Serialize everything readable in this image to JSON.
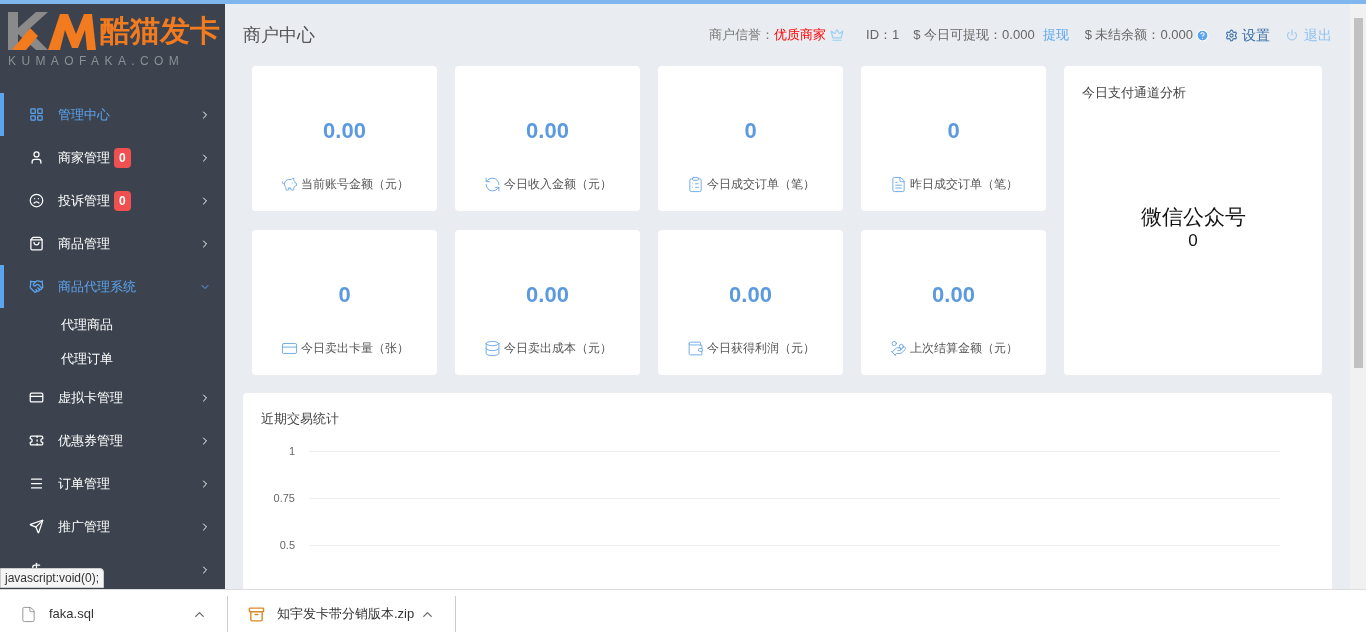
{
  "logo": {
    "brand": "酷猫发卡",
    "domain": "KUMAOFAKA.COM"
  },
  "sidebar": {
    "items": [
      {
        "label": "管理中心",
        "selected": true,
        "expanded": false
      },
      {
        "label": "商家管理",
        "badge": "0",
        "selected": false,
        "expanded": false
      },
      {
        "label": "投诉管理",
        "badge": "0",
        "selected": false,
        "expanded": false
      },
      {
        "label": "商品管理",
        "selected": false,
        "expanded": false
      },
      {
        "label": "商品代理系统",
        "selected": true,
        "expanded": true,
        "children": [
          {
            "label": "代理商品"
          },
          {
            "label": "代理订单"
          }
        ]
      },
      {
        "label": "虚拟卡管理",
        "selected": false,
        "expanded": false
      },
      {
        "label": "优惠券管理",
        "selected": false,
        "expanded": false
      },
      {
        "label": "订单管理",
        "selected": false,
        "expanded": false
      },
      {
        "label": "推广管理",
        "selected": false,
        "expanded": false
      },
      {
        "selected": false,
        "expanded": false
      }
    ]
  },
  "header": {
    "title": "商户中心",
    "reputation_label": "商户信誉：",
    "reputation": "优质商家",
    "id": "ID：1",
    "withdrawable": "$ 今日可提现：0.000",
    "withdraw_link": "提现",
    "unsettled": "$ 未结余额：0.000",
    "settings": "设置",
    "logout": "退出"
  },
  "stats": [
    {
      "value": "0.00",
      "label": "当前账号金额（元）"
    },
    {
      "value": "0.00",
      "label": "今日收入金额（元）"
    },
    {
      "value": "0",
      "label": "今日成交订单（笔）"
    },
    {
      "value": "0",
      "label": "昨日成交订单（笔）"
    },
    {
      "value": "0",
      "label": "今日卖出卡量（张）"
    },
    {
      "value": "0.00",
      "label": "今日卖出成本（元）"
    },
    {
      "value": "0.00",
      "label": "今日获得利润（元）"
    },
    {
      "value": "0.00",
      "label": "上次结算金额（元）"
    }
  ],
  "channel_panel": {
    "title": "今日支付通道分析",
    "channel": "微信公众号",
    "count": "0"
  },
  "trend_panel": {
    "title": "近期交易统计",
    "y_axis_labels": [
      "1",
      "0.75",
      "0.5"
    ]
  },
  "status_tooltip": "javascript:void(0);",
  "downloads": [
    {
      "name": "faka.sql",
      "kind": "file"
    },
    {
      "name": "知宇发卡带分销版本.zip",
      "kind": "archive"
    }
  ]
}
